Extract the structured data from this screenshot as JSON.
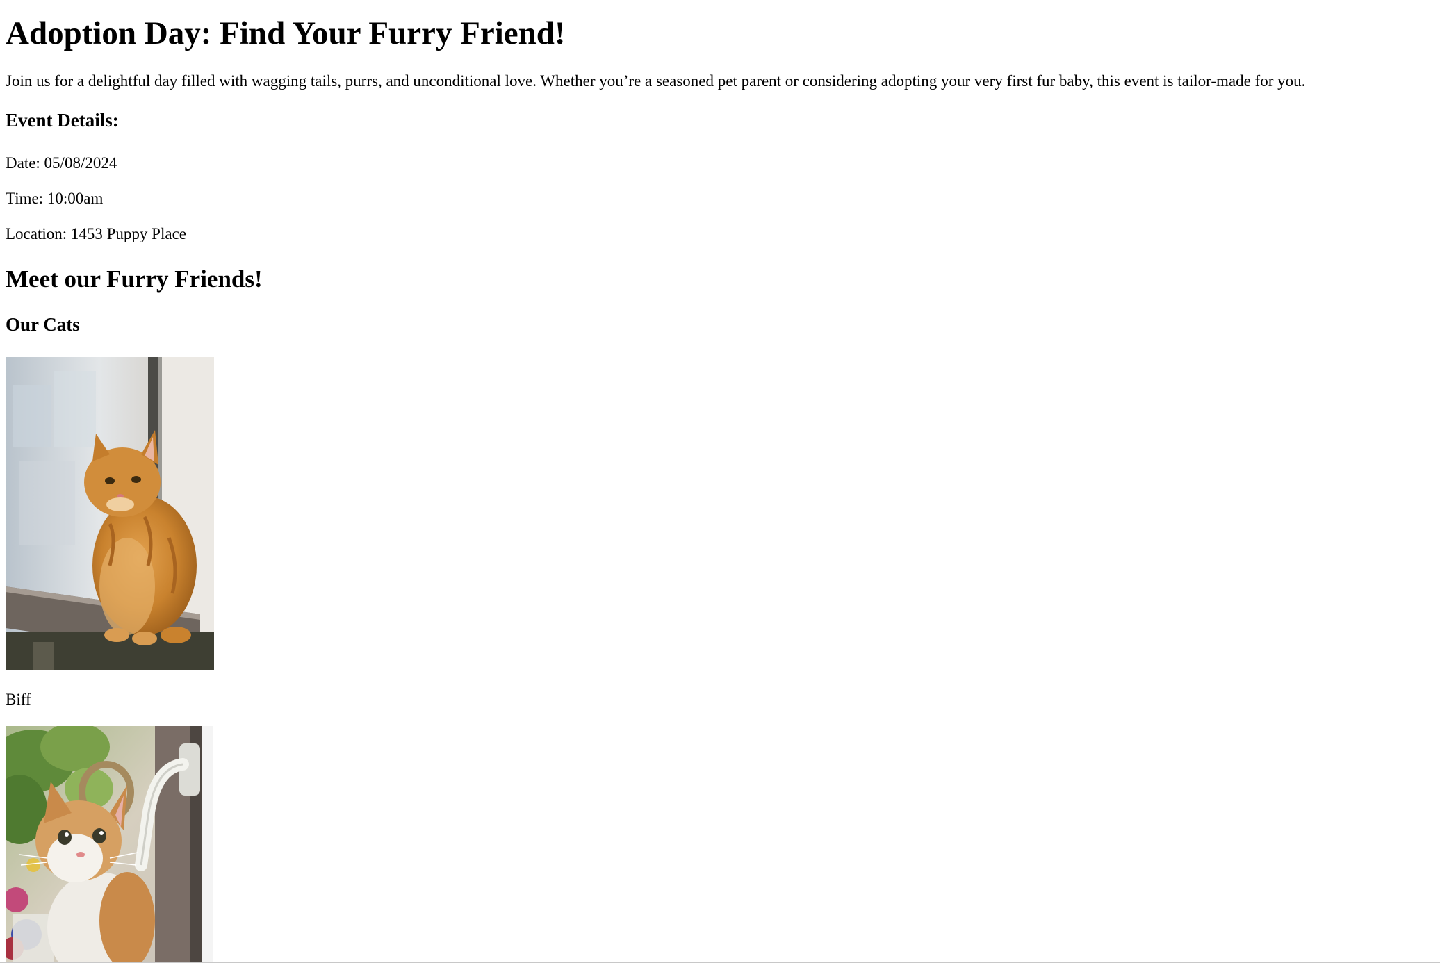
{
  "page": {
    "title": "Adoption Day: Find Your Furry Friend!",
    "intro": "Join us for a delightful day filled with wagging tails, purrs, and unconditional love. Whether you’re a seasoned pet parent or considering adopting your very first fur baby, this event is tailor-made for you."
  },
  "event": {
    "heading": "Event Details:",
    "date": "Date: 05/08/2024",
    "time": "Time: 10:00am",
    "location": "Location: 1453 Puppy Place"
  },
  "friends": {
    "heading": "Meet our Furry Friends!",
    "cats_heading": "Our Cats",
    "cats": [
      {
        "name": "Biff"
      },
      {
        "name": ""
      }
    ]
  }
}
